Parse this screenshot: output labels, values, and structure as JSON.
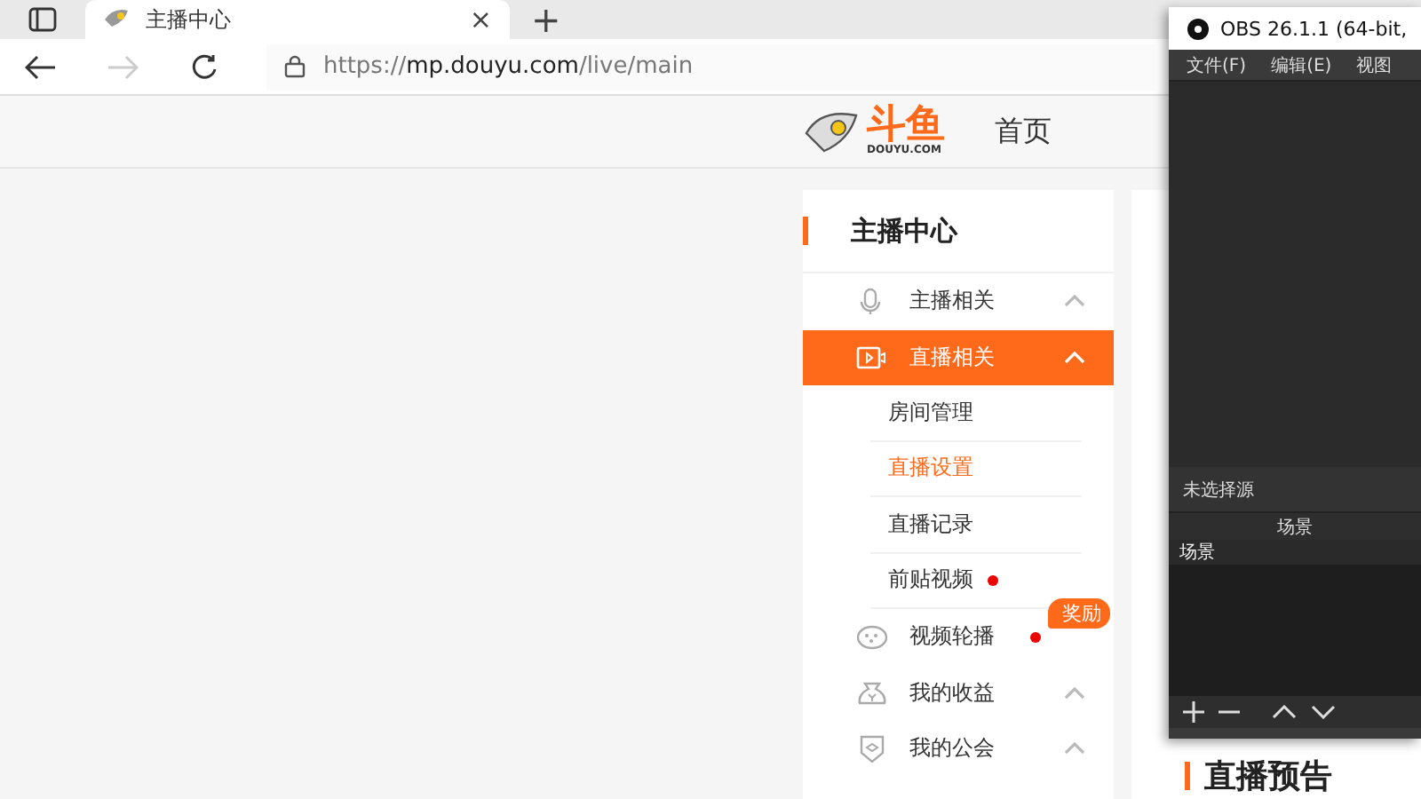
{
  "browser": {
    "tab": {
      "title": "主播中心",
      "close": "×"
    },
    "new_tab": "+",
    "url_host": "https://mp.douyu.com",
    "url_path": "/live/main"
  },
  "header": {
    "logo": "斗鱼",
    "logo_sub": "DOUYU.COM",
    "nav": [
      "首页"
    ]
  },
  "sidebar": {
    "title": "主播中心",
    "items": [
      {
        "kind": "group",
        "label": "主播相关",
        "selected": false,
        "dot": false
      },
      {
        "kind": "group",
        "label": "直播相关",
        "selected": true,
        "dot": false
      },
      {
        "kind": "sub",
        "label": "房间管理",
        "selected": false,
        "dot": false
      },
      {
        "kind": "sub",
        "label": "直播设置",
        "selected": true,
        "dot": false
      },
      {
        "kind": "sub",
        "label": "直播记录",
        "selected": false,
        "dot": false
      },
      {
        "kind": "sub",
        "label": "前贴视频",
        "selected": false,
        "dot": true
      },
      {
        "kind": "link",
        "label": "视频轮播",
        "selected": false,
        "dot": true,
        "badge": "奖励"
      },
      {
        "kind": "group",
        "label": "我的收益",
        "selected": false,
        "dot": false
      },
      {
        "kind": "group",
        "label": "我的公会",
        "selected": false,
        "dot": false
      }
    ]
  },
  "content": {
    "heading": "直播预告"
  },
  "obs": {
    "title": "OBS 26.1.1 (64-bit,",
    "menu": [
      "文件(F)",
      "编辑(E)",
      "视图"
    ],
    "source_label": "未选择源",
    "scenes_header": "场景",
    "scenes": [
      {
        "label": "场景",
        "selected": true
      }
    ]
  }
}
